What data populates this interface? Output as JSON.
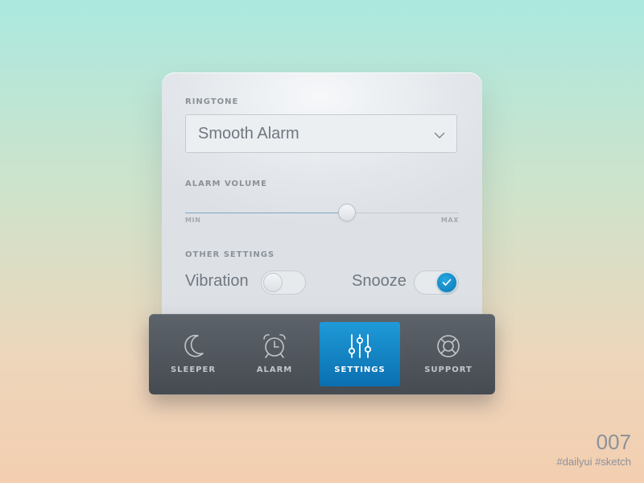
{
  "settings": {
    "ringtone_label": "RINGTONE",
    "ringtone_value": "Smooth Alarm",
    "volume_label": "ALARM VOLUME",
    "volume_level": 0.59,
    "volume_min_label": "MIN",
    "volume_max_label": "MAX",
    "other_label": "OTHER SETTINGS",
    "vibration": {
      "label": "Vibration",
      "on": false
    },
    "snooze": {
      "label": "Snooze",
      "on": true
    }
  },
  "nav": {
    "active": "settings",
    "items": [
      {
        "id": "sleeper",
        "label": "SLEEPER",
        "icon": "moon-icon"
      },
      {
        "id": "alarm",
        "label": "ALARM",
        "icon": "alarm-clock-icon"
      },
      {
        "id": "settings",
        "label": "SETTINGS",
        "icon": "sliders-icon"
      },
      {
        "id": "support",
        "label": "SUPPORT",
        "icon": "lifebuoy-icon"
      }
    ]
  },
  "colors": {
    "accent": "#0a8fcf",
    "navbar": "#51565d",
    "text": "#6f7780"
  },
  "footer": {
    "shot_number": "007",
    "tags": "#dailyui #sketch"
  }
}
